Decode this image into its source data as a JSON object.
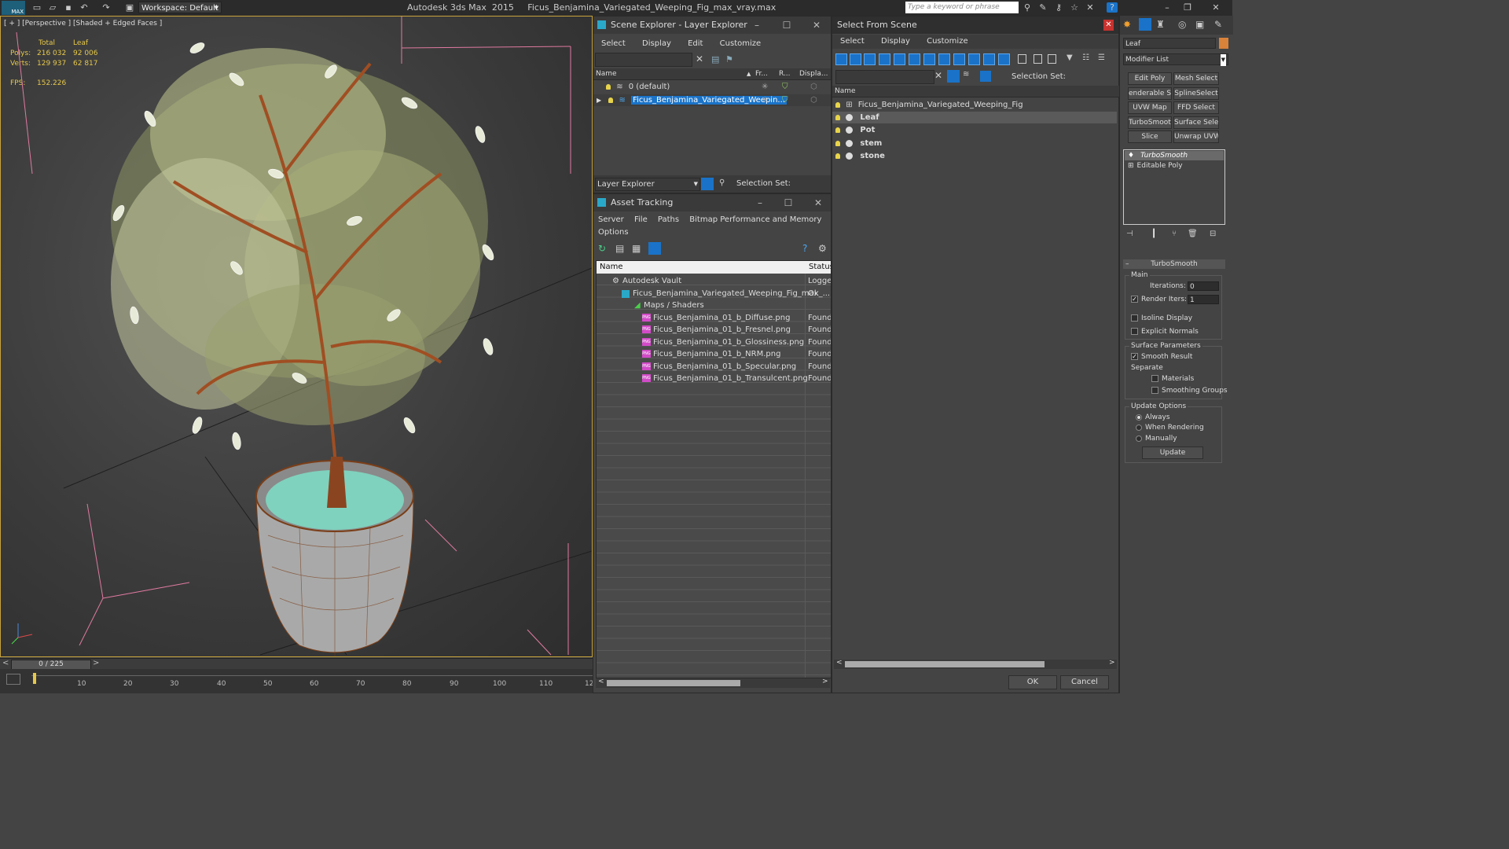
{
  "app": {
    "logo": "MAX",
    "title": "Autodesk 3ds Max  2015     Ficus_Benjamina_Variegated_Weeping_Fig_max_vray.max",
    "workspace": "Workspace: Default",
    "search_placeholder": "Type a keyword or phrase"
  },
  "viewport": {
    "label": "[ + ] [Perspective ] [Shaded + Edged Faces ]",
    "stats": {
      "col_total": "Total",
      "col_leaf": "Leaf",
      "polys_label": "Polys:",
      "polys_total": "216 032",
      "polys_leaf": "92 006",
      "verts_label": "Verts:",
      "verts_total": "129 937",
      "verts_leaf": "62 817",
      "fps_label": "FPS:",
      "fps_value": "152.226"
    }
  },
  "timeline": {
    "frame": "0 / 225",
    "ticks": [
      "10",
      "20",
      "30",
      "40",
      "50",
      "60",
      "70",
      "80",
      "90",
      "100",
      "110",
      "12"
    ]
  },
  "scene_explorer": {
    "title": "Scene Explorer - Layer Explorer",
    "menu": [
      "Select",
      "Display",
      "Edit",
      "Customize"
    ],
    "columns": {
      "name": "Name",
      "frozen": "Fr...",
      "render": "R...",
      "display": "Displa..."
    },
    "rows": [
      {
        "name": "0 (default)"
      },
      {
        "name": "Ficus_Benjamina_Variegated_Weepin..."
      }
    ],
    "footer_mode": "Layer Explorer",
    "selection_set": "Selection Set:"
  },
  "asset_tracking": {
    "title": "Asset Tracking",
    "menu": [
      "Server",
      "File",
      "Paths",
      "Bitmap Performance and Memory"
    ],
    "menu2": "Options",
    "columns": {
      "name": "Name",
      "status": "Status"
    },
    "rows": [
      {
        "name": "Autodesk Vault",
        "status": "Logge"
      },
      {
        "name": "Ficus_Benjamina_Variegated_Weeping_Fig_max_...",
        "status": "Ok"
      },
      {
        "name": "Maps / Shaders",
        "status": ""
      },
      {
        "name": "Ficus_Benjamina_01_b_Diffuse.png",
        "status": "Found"
      },
      {
        "name": "Ficus_Benjamina_01_b_Fresnel.png",
        "status": "Found"
      },
      {
        "name": "Ficus_Benjamina_01_b_Glossiness.png",
        "status": "Found"
      },
      {
        "name": "Ficus_Benjamina_01_b_NRM.png",
        "status": "Found"
      },
      {
        "name": "Ficus_Benjamina_01_b_Specular.png",
        "status": "Found"
      },
      {
        "name": "Ficus_Benjamina_01_b_Transulcent.png",
        "status": "Found"
      }
    ]
  },
  "select_from_scene": {
    "title": "Select From Scene",
    "menu": [
      "Select",
      "Display",
      "Customize"
    ],
    "selection_set": "Selection Set:",
    "column": "Name",
    "items": [
      {
        "name": "Ficus_Benjamina_Variegated_Weeping_Fig"
      },
      {
        "name": "Leaf"
      },
      {
        "name": "Pot"
      },
      {
        "name": "stem"
      },
      {
        "name": "stone"
      }
    ],
    "ok": "OK",
    "cancel": "Cancel"
  },
  "command_panel": {
    "object_name": "Leaf",
    "modifier_list": "Modifier List",
    "buttons": [
      "Edit Poly",
      "Mesh Select",
      "enderable Splir",
      "SplineSelect",
      "UVW Map",
      "FFD Select",
      "TurboSmooth",
      "Surface Select",
      "Slice",
      "Unwrap UVW"
    ],
    "stack": [
      "TurboSmooth",
      "Editable Poly"
    ],
    "rollout_title": "TurboSmooth",
    "main_label": "Main",
    "iterations_label": "Iterations:",
    "iterations_value": "0",
    "render_iters_label": "Render Iters:",
    "render_iters_value": "1",
    "isoline": "Isoline Display",
    "explicit": "Explicit Normals",
    "surface_params": "Surface Parameters",
    "smooth_result": "Smooth Result",
    "separate": "Separate",
    "materials": "Materials",
    "smoothing_groups": "Smoothing Groups",
    "update_options": "Update Options",
    "always": "Always",
    "when_rendering": "When Rendering",
    "manually": "Manually",
    "update": "Update"
  }
}
